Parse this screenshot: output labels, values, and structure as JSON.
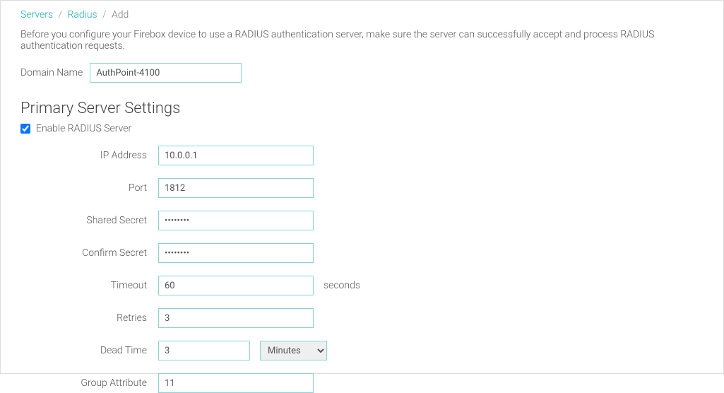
{
  "breadcrumb": {
    "servers": "Servers",
    "radius": "Radius",
    "current": "Add"
  },
  "intro": "Before you configure your Firebox device to use a RADIUS authentication server, make sure the server can successfully accept and process RADIUS authentication requests.",
  "domain": {
    "label": "Domain Name",
    "value": "AuthPoint-4100"
  },
  "section_title": "Primary Server Settings",
  "enable": {
    "label": "Enable RADIUS Server",
    "checked": true
  },
  "fields": {
    "ip_address": {
      "label": "IP Address",
      "value": "10.0.0.1"
    },
    "port": {
      "label": "Port",
      "value": "1812"
    },
    "shared_secret": {
      "label": "Shared Secret",
      "value": "••••••••"
    },
    "confirm_secret": {
      "label": "Confirm Secret",
      "value": "••••••••"
    },
    "timeout": {
      "label": "Timeout",
      "value": "60",
      "unit": "seconds"
    },
    "retries": {
      "label": "Retries",
      "value": "3"
    },
    "dead_time": {
      "label": "Dead Time",
      "value": "3",
      "unit_selected": "Minutes"
    },
    "group_attribute": {
      "label": "Group Attribute",
      "value": "11"
    }
  }
}
